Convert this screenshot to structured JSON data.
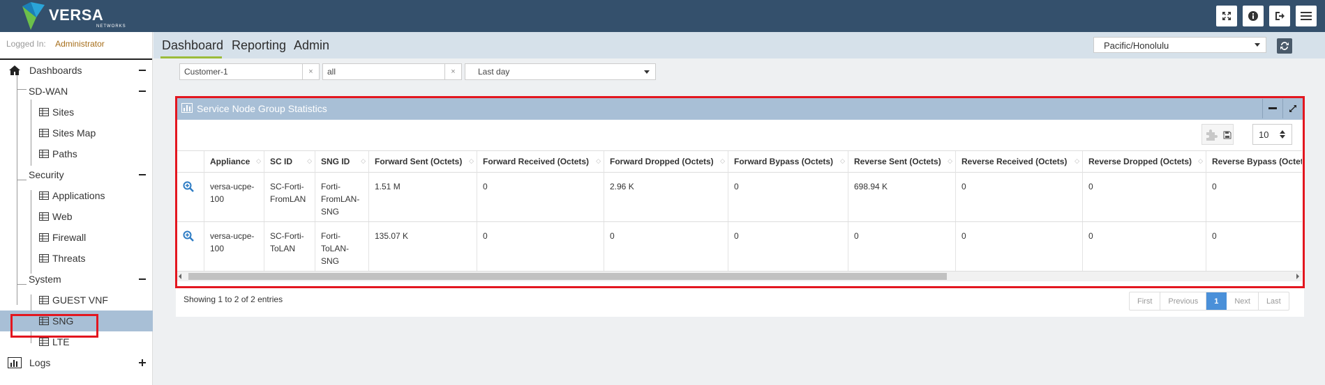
{
  "brand": {
    "name": "VERSA",
    "sub": "NETWORKS"
  },
  "icons": {
    "expand": "expand-icon",
    "info": "info-icon",
    "logout": "logout-icon",
    "menu": "hamburger-menu-icon",
    "refresh": "refresh-icon",
    "home": "home-icon",
    "table": "table-icon",
    "chart": "bar-chart-icon",
    "zoom": "zoom-in-icon",
    "plugin": "puzzle-icon",
    "save": "save-icon"
  },
  "colors": {
    "topbar": "#34506c",
    "accent": "#9bbb3b",
    "active": "#a8bfd6",
    "highlight": "#e3161f",
    "pager_current": "#4a90d9"
  },
  "session": {
    "logged_in_label": "Logged In:",
    "user": "Administrator"
  },
  "sidebar": {
    "dashboards": "Dashboards",
    "sdwan": "SD-WAN",
    "sdwan_items": [
      "Sites",
      "Sites Map",
      "Paths"
    ],
    "security": "Security",
    "security_items": [
      "Applications",
      "Web",
      "Firewall",
      "Threats"
    ],
    "system": "System",
    "system_items": [
      "GUEST VNF",
      "SNG",
      "LTE"
    ],
    "logs": "Logs"
  },
  "nav_tabs": [
    "Dashboard",
    "Reporting",
    "Admin"
  ],
  "timezone": "Pacific/Honolulu",
  "filters": {
    "org": "Customer-1",
    "scope": "all",
    "range": "Last day",
    "clear": "×"
  },
  "widget": {
    "title": "Service Node Group Statistics",
    "page_size": "10",
    "columns": [
      "Appliance",
      "SC ID",
      "SNG ID",
      "Forward Sent (Octets)",
      "Forward Received (Octets)",
      "Forward Dropped (Octets)",
      "Forward Bypass (Octets)",
      "Reverse Sent (Octets)",
      "Reverse Received (Octets)",
      "Reverse Dropped (Octets)",
      "Reverse Bypass (Octets)"
    ],
    "rows": [
      [
        "versa-ucpe-100",
        "SC-Forti-FromLAN",
        "Forti-FromLAN-SNG",
        "1.51 M",
        "0",
        "2.96 K",
        "0",
        "698.94 K",
        "0",
        "0",
        "0"
      ],
      [
        "versa-ucpe-100",
        "SC-Forti-ToLAN",
        "Forti-ToLAN-SNG",
        "135.07 K",
        "0",
        "0",
        "0",
        "0",
        "0",
        "0",
        "0"
      ]
    ],
    "showing": "Showing 1 to 2 of 2 entries",
    "pager": [
      "First",
      "Previous",
      "1",
      "Next",
      "Last"
    ]
  }
}
